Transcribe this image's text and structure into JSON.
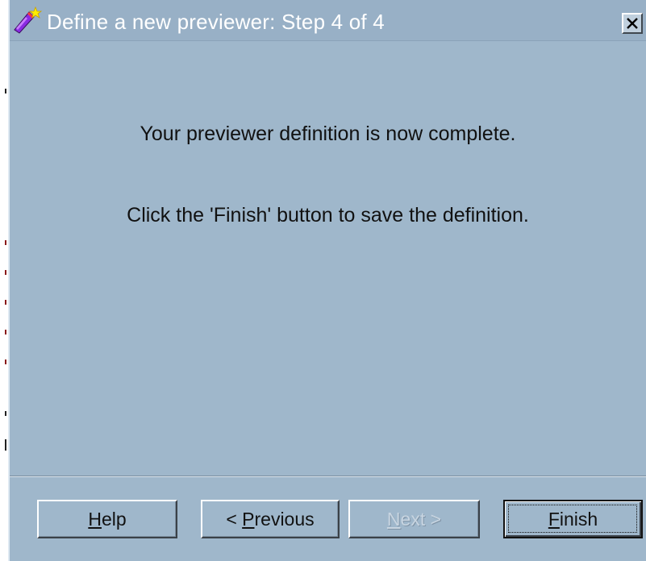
{
  "dialog": {
    "title": "Define a new previewer: Step 4 of 4",
    "title_icon": "wizard-wand-icon",
    "close_icon": "close-x-icon"
  },
  "content": {
    "line1": "Your previewer definition is now complete.",
    "line2": "Click the 'Finish' button to save the definition."
  },
  "buttons": {
    "help": {
      "mnemonic": "H",
      "rest": "elp",
      "enabled": true
    },
    "previous": {
      "prefix": "< ",
      "mnemonic": "P",
      "rest": "revious",
      "enabled": true
    },
    "next": {
      "mnemonic": "N",
      "rest": "ext >",
      "enabled": false
    },
    "finish": {
      "mnemonic": "F",
      "rest": "inish",
      "enabled": true,
      "default": true
    }
  },
  "colors": {
    "dialog_bg": "#9fb7cb",
    "title_text": "#ffffff"
  }
}
